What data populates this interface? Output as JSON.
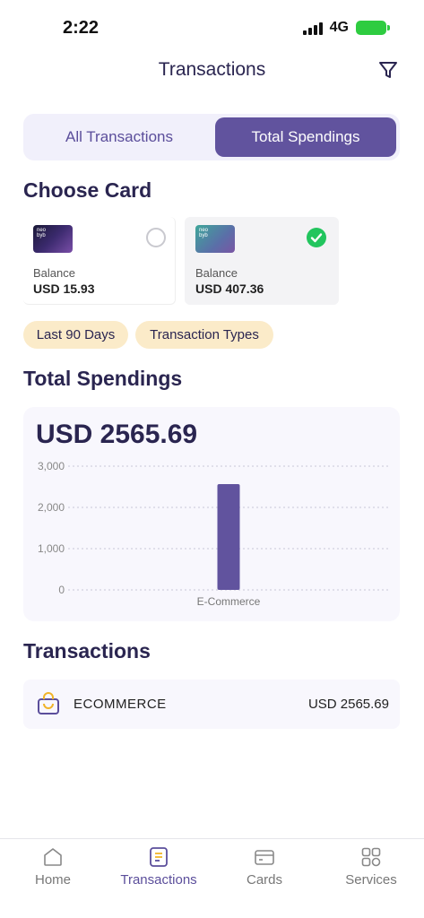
{
  "status_bar": {
    "time": "2:22",
    "network": "4G"
  },
  "header": {
    "title": "Transactions"
  },
  "segmented": {
    "all_label": "All Transactions",
    "total_label": "Total Spendings",
    "selected": "Total Spendings"
  },
  "choose_card": {
    "title": "Choose Card",
    "cards": [
      {
        "thumb_text": "neo\nbyb",
        "balance_label": "Balance",
        "balance": "USD 15.93",
        "selected": false
      },
      {
        "thumb_text": "neo\nbyb",
        "balance_label": "Balance",
        "balance": "USD 407.36",
        "selected": true
      }
    ]
  },
  "filters": {
    "period": "Last 90 Days",
    "types": "Transaction Types"
  },
  "total_spendings": {
    "title": "Total Spendings",
    "total": "USD 2565.69"
  },
  "chart_data": {
    "type": "bar",
    "categories": [
      "E-Commerce"
    ],
    "values": [
      2565.69
    ],
    "ylim": [
      0,
      3000
    ],
    "yticks": [
      "0",
      "1,000",
      "2,000",
      "3,000"
    ],
    "grid": true,
    "bar_color": "#61539e"
  },
  "transactions": {
    "title": "Transactions",
    "items": [
      {
        "name": "ECOMMERCE",
        "amount": "USD 2565.69",
        "icon": "shopping-bag-icon"
      }
    ]
  },
  "bottom_nav": {
    "items": [
      {
        "label": "Home",
        "icon": "home-icon",
        "active": false
      },
      {
        "label": "Transactions",
        "icon": "receipt-icon",
        "active": true
      },
      {
        "label": "Cards",
        "icon": "card-icon",
        "active": false
      },
      {
        "label": "Services",
        "icon": "grid-icon",
        "active": false
      }
    ]
  },
  "colors": {
    "accent": "#61539e",
    "chip_bg": "#fbebc9",
    "success": "#22c55e"
  }
}
